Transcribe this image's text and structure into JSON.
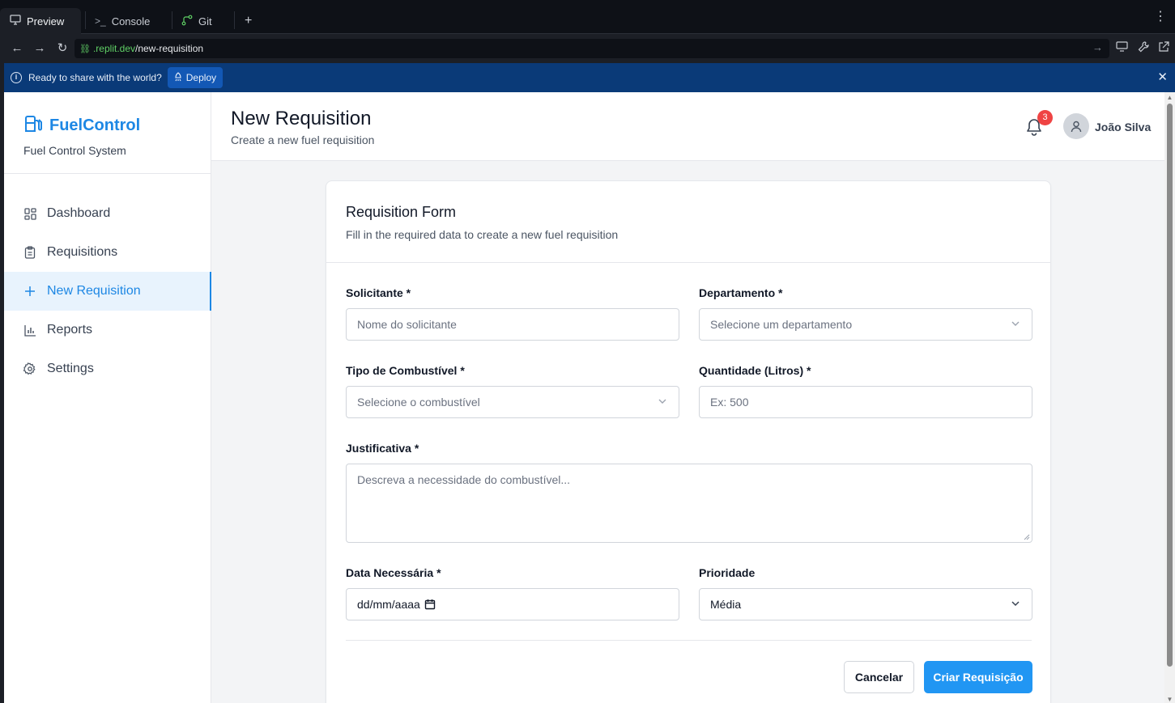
{
  "ide": {
    "tabs": [
      {
        "label": "Preview",
        "icon": "monitor-icon"
      },
      {
        "label": "Console",
        "icon": "terminal-icon"
      },
      {
        "label": "Git",
        "icon": "git-icon"
      }
    ],
    "new_tab": "+",
    "url_host": ".replit.dev",
    "url_path": "/new-requisition",
    "banner_message": "Ready to share with the world?",
    "deploy_label": "Deploy"
  },
  "sidebar": {
    "brand_name": "FuelControl",
    "brand_subtitle": "Fuel Control System",
    "items": [
      {
        "label": "Dashboard",
        "icon": "dashboard-icon"
      },
      {
        "label": "Requisitions",
        "icon": "clipboard-icon"
      },
      {
        "label": "New Requisition",
        "icon": "plus-icon",
        "active": true
      },
      {
        "label": "Reports",
        "icon": "bar-chart-icon"
      },
      {
        "label": "Settings",
        "icon": "gear-icon"
      }
    ]
  },
  "header": {
    "title": "New Requisition",
    "subtitle": "Create a new fuel requisition",
    "notification_count": "3",
    "user_name": "João Silva"
  },
  "form": {
    "title": "Requisition Form",
    "description": "Fill in the required data to create a new fuel requisition",
    "solicitante_label": "Solicitante *",
    "solicitante_placeholder": "Nome do solicitante",
    "departamento_label": "Departamento *",
    "departamento_placeholder": "Selecione um departamento",
    "combustivel_label": "Tipo de Combustível *",
    "combustivel_placeholder": "Selecione o combustível",
    "quantidade_label": "Quantidade (Litros) *",
    "quantidade_placeholder": "Ex: 500",
    "justificativa_label": "Justificativa *",
    "justificativa_placeholder": "Descreva a necessidade do combustível...",
    "data_label": "Data Necessária *",
    "data_value": "dd/mm/aaaa",
    "prioridade_label": "Prioridade",
    "prioridade_value": "Média",
    "cancel_label": "Cancelar",
    "submit_label": "Criar Requisição"
  },
  "colors": {
    "accent": "#1d87e4",
    "primary_button": "#2196f3",
    "badge": "#ef4444",
    "banner": "#0a3a78"
  }
}
